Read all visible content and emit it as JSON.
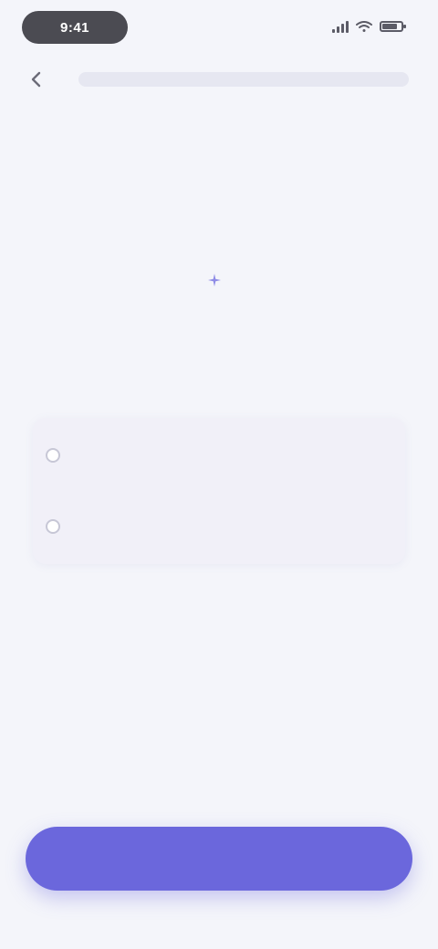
{
  "status_bar": {
    "time": "9:41",
    "icons": [
      "signal-icon",
      "wifi-icon",
      "battery-icon"
    ],
    "battery_level": 0.8
  },
  "nav": {
    "back_icon": "chevron-left-icon",
    "url": ""
  },
  "promo": {
    "title": "",
    "subtitle": ""
  },
  "options": [
    {
      "label": ""
    },
    {
      "label": ""
    }
  ],
  "primary_button": {
    "label": ""
  },
  "colors": {
    "background": "#f4f5fa",
    "accent": "#6b67dc",
    "accent_text": "#6a6ad8",
    "card": "#f1f0f8"
  }
}
